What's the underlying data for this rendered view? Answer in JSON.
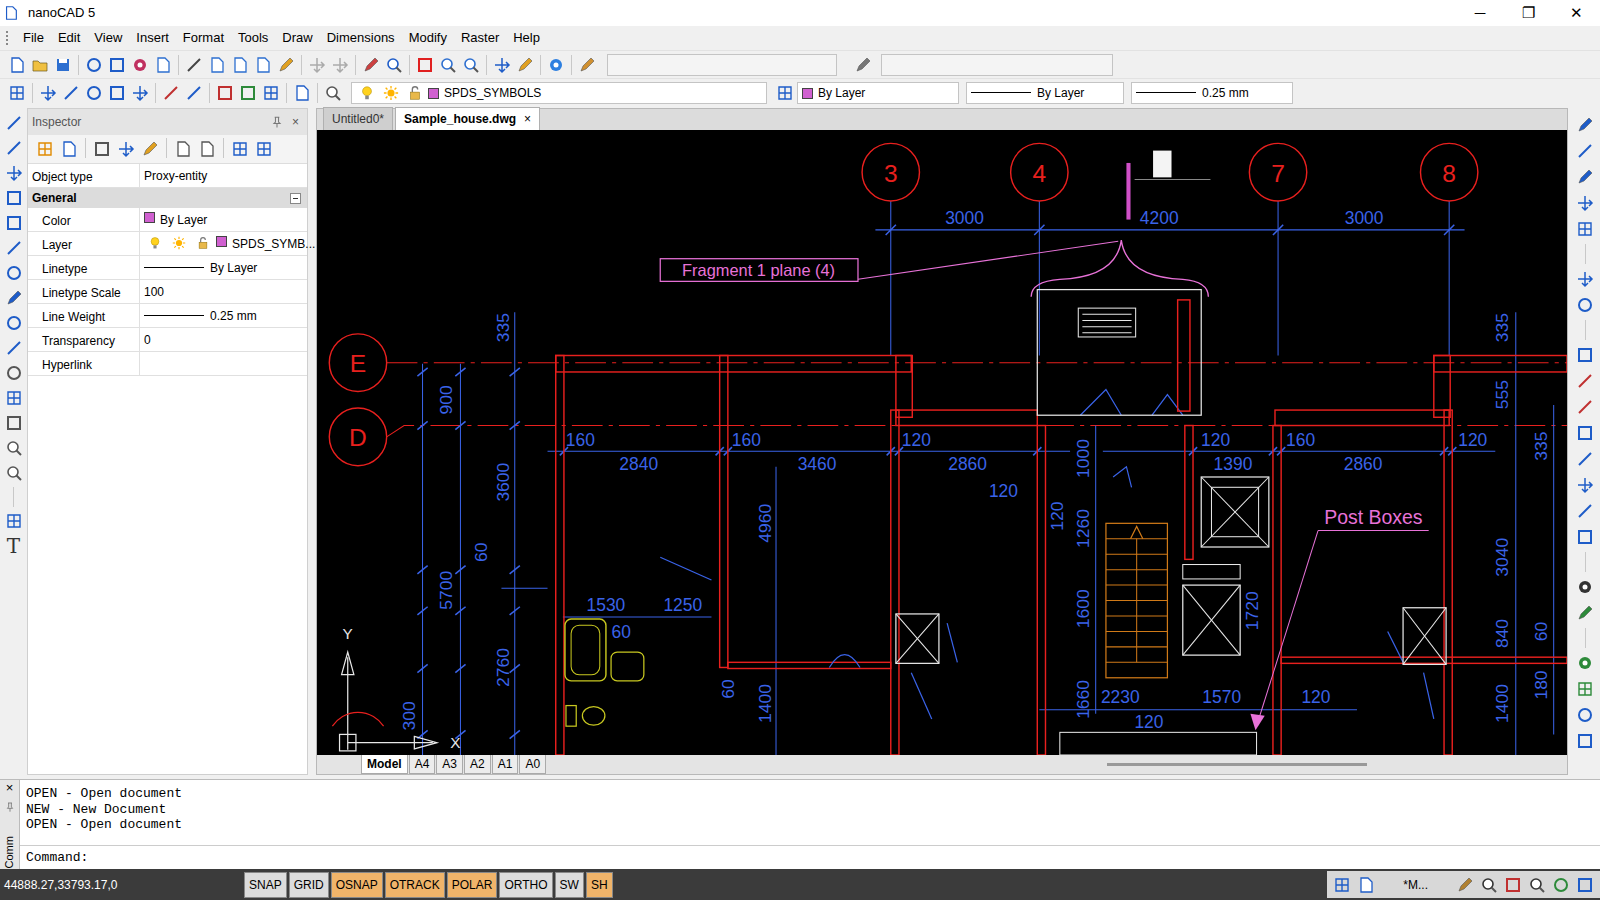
{
  "window": {
    "title": "nanoCAD 5",
    "controls": [
      "─",
      "❐",
      "✕"
    ]
  },
  "menu": [
    "File",
    "Edit",
    "View",
    "Insert",
    "Format",
    "Tools",
    "Draw",
    "Dimensions",
    "Modify",
    "Raster",
    "Help"
  ],
  "toolbar": {
    "layer": "SPDS_SYMBOLS",
    "color": "By Layer",
    "linetype": "By Layer",
    "lineweight": "0.25 mm"
  },
  "left_tools": {
    "text_tool": "T"
  },
  "inspector": {
    "title": "Inspector",
    "close": "×",
    "object_type": {
      "label": "Object type",
      "value": "Proxy-entity"
    },
    "section": {
      "label": "General",
      "expanded": true
    },
    "properties": [
      {
        "label": "Color",
        "value": "By Layer",
        "kind": "swatch"
      },
      {
        "label": "Layer",
        "value": "SPDS_SYMB...",
        "kind": "layer"
      },
      {
        "label": "Linetype",
        "value": "By Layer",
        "kind": "line"
      },
      {
        "label": "Linetype Scale",
        "value": "100",
        "kind": "text"
      },
      {
        "label": "Line Weight",
        "value": "0.25 mm",
        "kind": "line"
      },
      {
        "label": "Transparency",
        "value": "0",
        "kind": "text"
      },
      {
        "label": "Hyperlink",
        "kind": "empty"
      }
    ]
  },
  "doc_tabs": [
    {
      "label": "Untitled0*",
      "selected": false
    },
    {
      "label": "Sample_house.dwg",
      "selected": true
    }
  ],
  "doc_close": "×",
  "drawing": {
    "axes": [
      "3",
      "4",
      "7",
      "8",
      "E",
      "D"
    ],
    "dims_h": [
      "3000",
      "4200",
      "3000",
      "160",
      "2840",
      "160",
      "3460",
      "120",
      "2860",
      "120",
      "120",
      "1390",
      "160",
      "2860",
      "120",
      "1530",
      "60",
      "1250",
      "2230",
      "1570",
      "120",
      "120"
    ],
    "dims_v": [
      "335",
      "900",
      "3600",
      "60",
      "5700",
      "4960",
      "2760",
      "300",
      "60",
      "1400",
      "1000",
      "120",
      "1260",
      "1600",
      "1660",
      "1720",
      "335",
      "555",
      "335",
      "3040",
      "840",
      "60",
      "1400",
      "180"
    ],
    "fragment_label": "Fragment 1 plane (4)",
    "post_label": "Post Boxes",
    "ucs": {
      "y": "Y",
      "x": "X"
    }
  },
  "layout_tabs": [
    {
      "label": "Model",
      "selected": true
    },
    {
      "label": "A4",
      "selected": false
    },
    {
      "label": "A3",
      "selected": false
    },
    {
      "label": "A2",
      "selected": false
    },
    {
      "label": "A1",
      "selected": false
    },
    {
      "label": "A0",
      "selected": false
    }
  ],
  "command": {
    "label": "Comm",
    "close": "×",
    "history": [
      "OPEN - Open document",
      "NEW - New Document",
      "OPEN - Open document"
    ],
    "prompt": "Command:"
  },
  "status": {
    "coords": "44888.27,33793.17,0",
    "toggles": [
      {
        "label": "SNAP",
        "on": false
      },
      {
        "label": "GRID",
        "on": false
      },
      {
        "label": "OSNAP",
        "on": true
      },
      {
        "label": "OTRACK",
        "on": true
      },
      {
        "label": "POLAR",
        "on": true
      },
      {
        "label": "ORTHO",
        "on": false
      },
      {
        "label": "SW",
        "on": false
      },
      {
        "label": "SH",
        "on": true
      }
    ],
    "space": "*M..."
  }
}
